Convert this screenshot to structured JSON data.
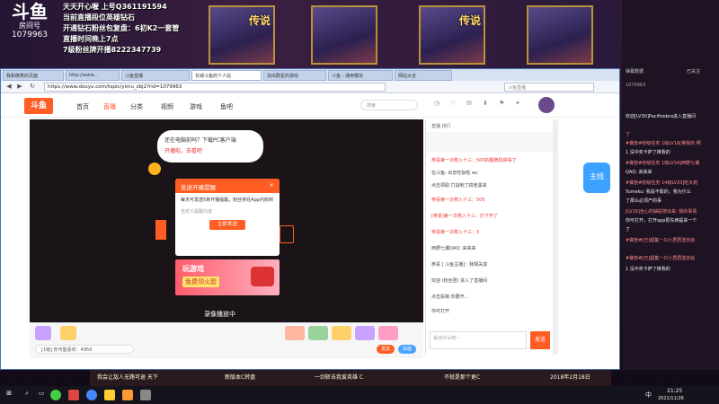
{
  "stream_banner": {
    "logo_text": "斗鱼",
    "room_label": "房间号",
    "room_id": "1079963",
    "lines": [
      "天天开心喔 上号Q361191594",
      "当前直播段位英雄钻石",
      "开通钻石粉丝包复盘：6初K2一套管",
      "直播时间晚上7点",
      "7级粉丝牌开播8222347739"
    ],
    "hero_labels": [
      "传说",
      "传说"
    ]
  },
  "browser": {
    "tabs": [
      "我和微笑的页面",
      "http://www...",
      "斗鱼直播",
      "长城斗鱼的个人站",
      "逃出群星的游戏",
      "斗鱼 - 通用模块",
      "网站大全"
    ],
    "url": "https://www.douyu.com/topic/yimu_zbj2?rid=1079963",
    "search_placeholder": "斗鱼直播"
  },
  "site": {
    "logo": "斗鱼",
    "nav": [
      "首页",
      "直播",
      "分类",
      "视频",
      "游戏",
      "鱼吧"
    ],
    "search_placeholder": "搜索"
  },
  "player": {
    "cloud_bubble": "还在电脑前吗？下载PC客户端",
    "cloud_bubble2": "开播啦，去看吧",
    "dialog_title": "发送开播提醒",
    "dialog_body": "每天可发送5条开播提醒，粉丝将在App内收到",
    "dialog_note": "自定义提醒内容",
    "dialog_button": "立即发送",
    "promo_title": "玩游戏",
    "promo_sub": "免费领火箭",
    "recording_label": "录像播放中"
  },
  "chat": {
    "top_label": "直播 排行",
    "lines": [
      "恭喜第一次称入十三：500的翻牌机获得了",
      "在斗鱼: 出去吃饭啦 wc",
      "点击领取 打战到了搞老黑来",
      "恭喜第一次称入十三：500",
      "[恭喜]第一次称入十三：打下开了",
      "恭喜第一次称入十三：3",
      "西野七瀬QAQ: 来来来",
      "恭喜 [ 斗鱼主播]：我相关成",
      "欢迎 (粉丝团) 进入了直播间",
      "点击投稿 你要开...",
      "你可打开"
    ],
    "input_placeholder": "说点什么吧~",
    "send_label": "发送"
  },
  "gift_bar": {
    "input_text": "[1级] 你可能喜欢：4950",
    "send_label": "发送",
    "recharge_label": "充值"
  },
  "right_panel": {
    "title": "弹幕数据",
    "count_label": "1079963",
    "lines": [
      "欢迎[LV30]Pacifizebra进入直播间",
      "了",
      "#做管#初级任务 1级LV16[推我的 啊",
      "1 没中奖卡萨了推我的",
      "#做管#初级任务 1级LV34]西野七瀬",
      "QAQ: 来来来",
      "#做管#初级任务 14级LV33]吃大炮",
      "Yumeku: 我是不敢的，我为什么",
      "了那么必须产的事",
      "[LV18]全心的抽屉搜出来: 我的事情",
      "你可打开，打开app把东西提来一个",
      "了",
      "#做管#[已]超集一只小君君送去给",
      "#做管#[已]超集一只小君君送去给",
      "1 没中奖卡萨了推我的"
    ],
    "watermark": "已关注"
  },
  "promo_strip": [
    "我会让敌人无路可退 天下",
    "新版本C转盘",
    "一剑斩去我爱英雄 C",
    "不就是那个更C",
    "2018年2月18日"
  ],
  "taskbar": {
    "time": "21:25",
    "date": "2021/11/26",
    "lang": "中"
  }
}
